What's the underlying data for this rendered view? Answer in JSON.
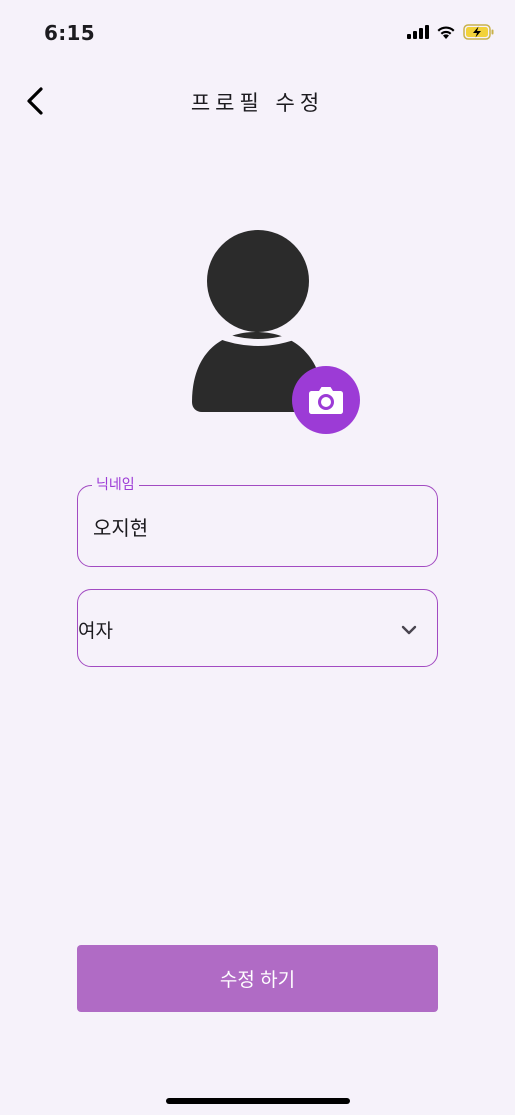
{
  "status_bar": {
    "time": "6:15"
  },
  "header": {
    "title": "프로필 수정",
    "back_icon": "chevron-left-icon"
  },
  "avatar": {
    "icon": "person-icon",
    "camera_icon": "camera-icon",
    "accent_color": "#9c3bd6"
  },
  "form": {
    "nickname": {
      "label": "닉네임",
      "value": "오지현"
    },
    "gender": {
      "selected": "여자",
      "icon": "chevron-down-icon"
    }
  },
  "submit": {
    "label": "수정 하기",
    "color": "#b06bc5"
  }
}
